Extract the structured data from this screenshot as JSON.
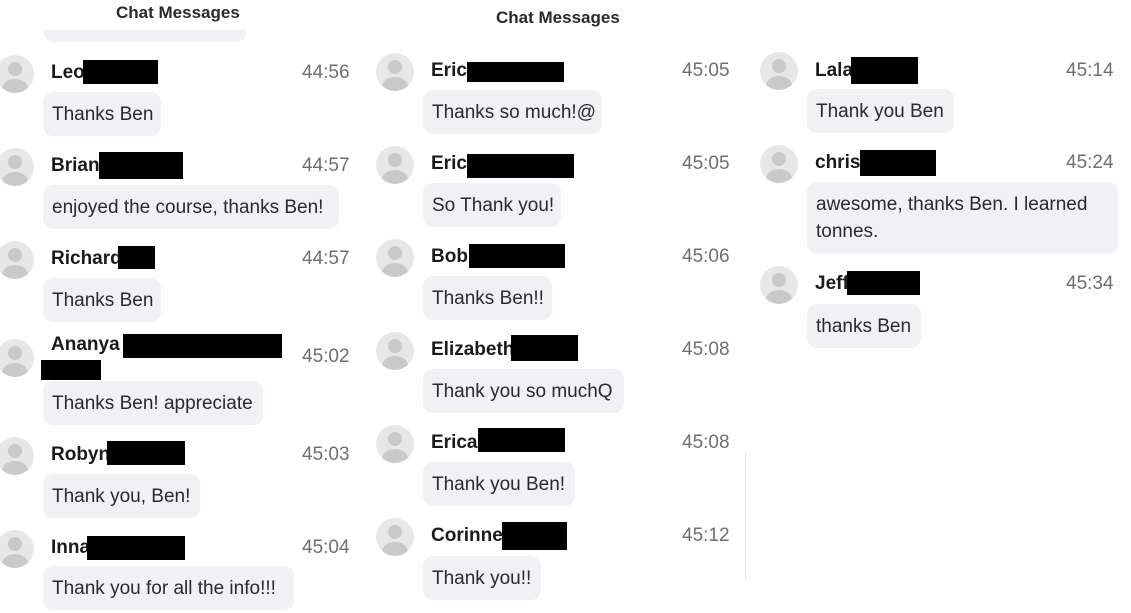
{
  "panels": [
    {
      "title": "Chat Messages"
    },
    {
      "title": "Chat Messages"
    }
  ],
  "messages": [
    {
      "name": "Leo",
      "time": "44:56",
      "text": "Thanks Ben"
    },
    {
      "name": "Brian",
      "time": "44:57",
      "text": "enjoyed the course, thanks Ben!"
    },
    {
      "name": "Richard",
      "time": "44:57",
      "text": "Thanks Ben"
    },
    {
      "name": "Ananya",
      "time": "45:02",
      "text": "Thanks Ben! appreciate"
    },
    {
      "name": "Robyn",
      "time": "45:03",
      "text": "Thank you, Ben!"
    },
    {
      "name": "Inna",
      "time": "45:04",
      "text": "Thank you for all the info!!!"
    },
    {
      "name": "Eric",
      "time": "45:05",
      "text": "Thanks so much!@"
    },
    {
      "name": "Eric",
      "time": "45:05",
      "text": "So Thank you!"
    },
    {
      "name": "Bob",
      "time": "45:06",
      "text": "Thanks Ben!!"
    },
    {
      "name": "Elizabeth",
      "time": "45:08",
      "text": "Thank you so muchQ"
    },
    {
      "name": "Erica",
      "time": "45:08",
      "text": "Thank you Ben!"
    },
    {
      "name": "Corinne",
      "time": "45:12",
      "text": "Thank you!!"
    },
    {
      "name": "Lala",
      "time": "45:14",
      "text": "Thank you Ben"
    },
    {
      "name": "chris",
      "time": "45:24",
      "text": "awesome, thanks Ben. I learned tonnes."
    },
    {
      "name": "Jeff",
      "time": "45:34",
      "text": "thanks Ben"
    }
  ]
}
